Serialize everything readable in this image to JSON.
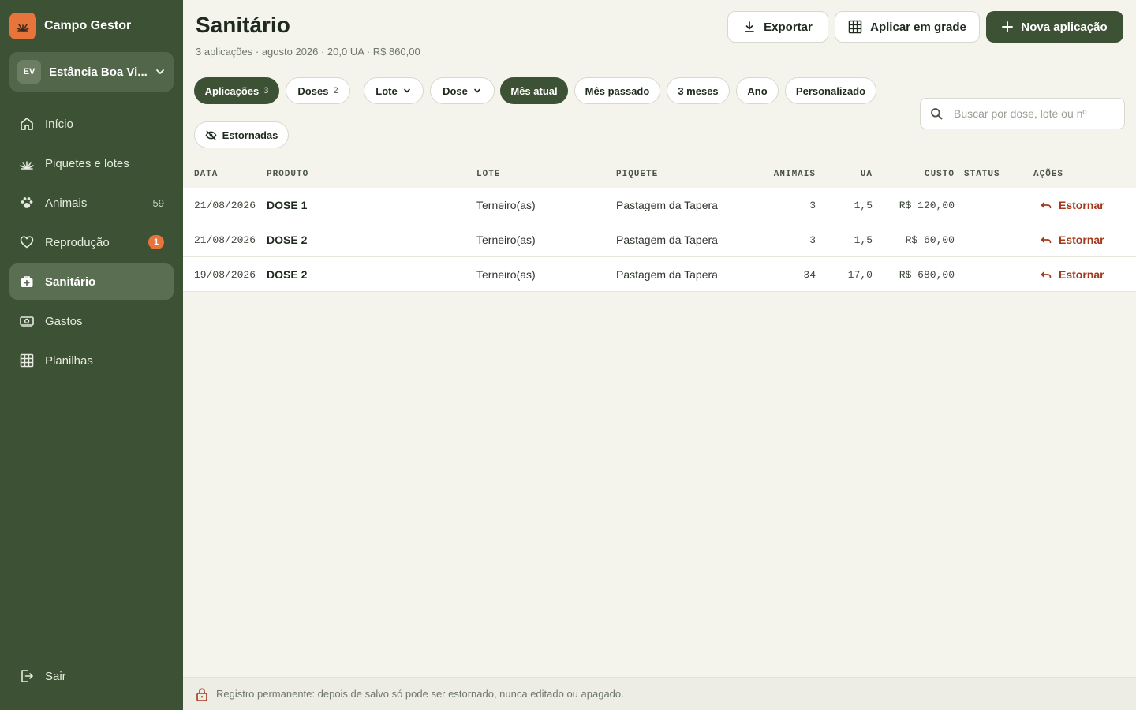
{
  "app": {
    "name": "Campo Gestor"
  },
  "farm": {
    "initials": "EV",
    "name": "Estância Boa Vi..."
  },
  "nav": [
    {
      "label": "Início",
      "icon": "home-icon"
    },
    {
      "label": "Piquetes e lotes",
      "icon": "grass-icon"
    },
    {
      "label": "Animais",
      "icon": "paw-icon",
      "count": "59"
    },
    {
      "label": "Reprodução",
      "icon": "heart-icon",
      "badge": "1"
    },
    {
      "label": "Sanitário",
      "icon": "medical-kit-icon",
      "active": true
    },
    {
      "label": "Gastos",
      "icon": "cash-icon"
    },
    {
      "label": "Planilhas",
      "icon": "grid-icon"
    }
  ],
  "logout": {
    "label": "Sair"
  },
  "page": {
    "title": "Sanitário",
    "subtitle": "3 aplicações · agosto 2026 · 20,0 UA · R$ 860,00"
  },
  "actions": {
    "export": "Exportar",
    "apply_grid": "Aplicar em grade",
    "new": "Nova aplicação"
  },
  "filters": {
    "tabs": [
      {
        "label": "Aplicações",
        "count": "3",
        "active": true
      },
      {
        "label": "Doses",
        "count": "2"
      }
    ],
    "dropdowns": [
      "Lote",
      "Dose"
    ],
    "periods": [
      {
        "label": "Mês atual",
        "active": true
      },
      {
        "label": "Mês passado"
      },
      {
        "label": "3 meses"
      },
      {
        "label": "Ano"
      },
      {
        "label": "Personalizado"
      }
    ],
    "reversed": "Estornadas"
  },
  "search": {
    "placeholder": "Buscar por dose, lote ou nº",
    "value": ""
  },
  "table": {
    "columns": [
      "DATA",
      "PRODUTO",
      "LOTE",
      "PIQUETE",
      "ANIMAIS",
      "UA",
      "CUSTO",
      "STATUS",
      "AÇÕES"
    ],
    "rows": [
      {
        "date": "21/08/2026",
        "product": "DOSE 1",
        "lot": "Terneiro(as)",
        "paddock": "Pastagem da Tapera",
        "animals": "3",
        "ua": "1,5",
        "cost": "R$ 120,00",
        "status": "",
        "action": "Estornar"
      },
      {
        "date": "21/08/2026",
        "product": "DOSE 2",
        "lot": "Terneiro(as)",
        "paddock": "Pastagem da Tapera",
        "animals": "3",
        "ua": "1,5",
        "cost": "R$ 60,00",
        "status": "",
        "action": "Estornar"
      },
      {
        "date": "19/08/2026",
        "product": "DOSE 2",
        "lot": "Terneiro(as)",
        "paddock": "Pastagem da Tapera",
        "animals": "34",
        "ua": "17,0",
        "cost": "R$ 680,00",
        "status": "",
        "action": "Estornar"
      }
    ]
  },
  "footer": {
    "note": "Registro permanente: depois de salvo só pode ser estornado, nunca editado ou apagado."
  },
  "colors": {
    "sidebar": "#3d5234",
    "accent": "#e8743b",
    "danger": "#a33a1e",
    "background": "#f4f3ec"
  }
}
